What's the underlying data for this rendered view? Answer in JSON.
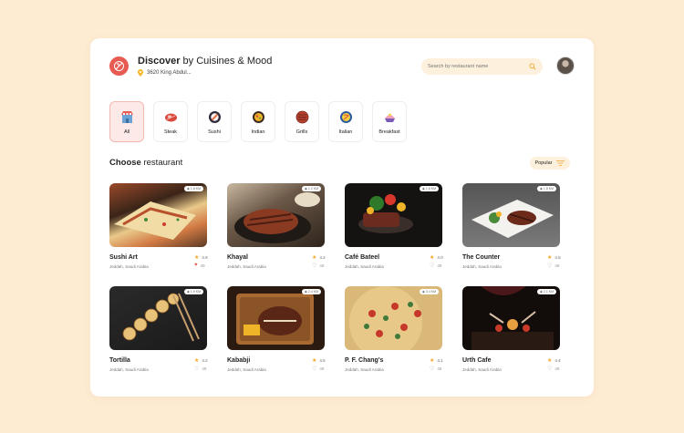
{
  "header": {
    "title_bold": "Discover",
    "title_rest": " by Cuisines & Mood",
    "location": "3620 King Abdul..."
  },
  "search": {
    "placeholder": "Search by restaurant name"
  },
  "categories": [
    {
      "label": "All",
      "icon": "store-icon",
      "active": true
    },
    {
      "label": "Steak",
      "icon": "steak-icon"
    },
    {
      "label": "Sushi",
      "icon": "sushi-icon"
    },
    {
      "label": "Indian",
      "icon": "indian-icon"
    },
    {
      "label": "Grills",
      "icon": "grills-icon"
    },
    {
      "label": "Italian",
      "icon": "italian-icon"
    },
    {
      "label": "Breakfast",
      "icon": "breakfast-icon"
    }
  ],
  "section": {
    "title_bold": "Choose",
    "title_rest": " restaurant",
    "sort_label": "Popular"
  },
  "restaurants": [
    {
      "name": "Sushi Art",
      "address": "Jeddah, Saudi Arabia",
      "rating": "4.9",
      "favs": "49",
      "distance": "1.8 KM",
      "faved": true
    },
    {
      "name": "Khayal",
      "address": "Jeddah, Saudi Arabia",
      "rating": "4.2",
      "favs": "49",
      "distance": "1.2 KM"
    },
    {
      "name": "Café Bateel",
      "address": "Jeddah, Saudi Arabia",
      "rating": "4.0",
      "favs": "49",
      "distance": "1.6 KM"
    },
    {
      "name": "The Counter",
      "address": "Jeddah, Saudi Arabia",
      "rating": "4.5",
      "favs": "49",
      "distance": "1.8 KM"
    },
    {
      "name": "Tortilla",
      "address": "Jeddah, Saudi Arabia",
      "rating": "4.2",
      "favs": "49",
      "distance": "1.9 KM"
    },
    {
      "name": "Kababji",
      "address": "Jeddah, Saudi Arabia",
      "rating": "4.5",
      "favs": "49",
      "distance": "2.4 KM"
    },
    {
      "name": "P. F. Chang's",
      "address": "Jeddah, Saudi Arabia",
      "rating": "4.1",
      "favs": "49",
      "distance": "3.4 KM"
    },
    {
      "name": "Urth Cafe",
      "address": "Jeddah, Saudi Arabia",
      "rating": "4.4",
      "favs": "49",
      "distance": "2.1 KM"
    }
  ],
  "colors": {
    "accent": "#e85b52",
    "star": "#f5a623",
    "search_bg": "#fdf1dd",
    "page_bg": "#fdebd2"
  }
}
